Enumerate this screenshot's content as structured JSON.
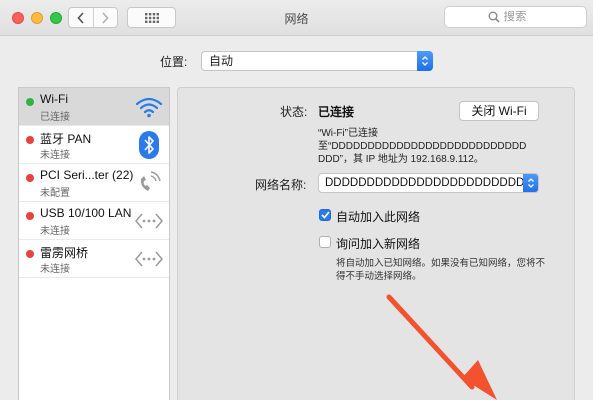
{
  "window": {
    "title": "网络",
    "search_placeholder": "搜索"
  },
  "location": {
    "label": "位置:",
    "value": "自动"
  },
  "sidebar": {
    "items": [
      {
        "name": "Wi-Fi",
        "status": "已连接",
        "dot_color": "#2fb344",
        "icon": "wifi-icon",
        "selected": true
      },
      {
        "name": "蓝牙 PAN",
        "status": "未连接",
        "dot_color": "#e5433c",
        "icon": "bluetooth-icon"
      },
      {
        "name": "PCI Seri...ter (22)",
        "status": "未配置",
        "dot_color": "#e5433c",
        "icon": "phone-icon"
      },
      {
        "name": "USB 10/100 LAN",
        "status": "未连接",
        "dot_color": "#e5433c",
        "icon": "ethernet-icon"
      },
      {
        "name": "雷雳网桥",
        "status": "未连接",
        "dot_color": "#e5433c",
        "icon": "ethernet-icon"
      }
    ]
  },
  "detail": {
    "status_label": "状态:",
    "status_value": "已连接",
    "turn_off_button": "关闭 Wi-Fi",
    "description_line1": "“Wi-Fi”已连接",
    "description_line2": "至“DDDDDDDDDDDDDDDDDDDDDDDDDDD",
    "description_line3": "DDD”，其 IP 地址为 192.168.9.112。",
    "network_name_label": "网络名称:",
    "network_name_value": "DDDDDDDDDDDDDDDDDDDDDDDD...",
    "auto_join_label": "自动加入此网络",
    "auto_join_checked": true,
    "ask_join_label": "询问加入新网络",
    "ask_join_checked": false,
    "help_line1": "将自动加入已知网络。如果没有已知网络，您将不",
    "help_line2": "得不手动选择网络。"
  },
  "colors": {
    "accent": "#2a7ae9",
    "connected": "#2fb344",
    "disconnected": "#e5433c",
    "arrow": "#f2522e"
  }
}
